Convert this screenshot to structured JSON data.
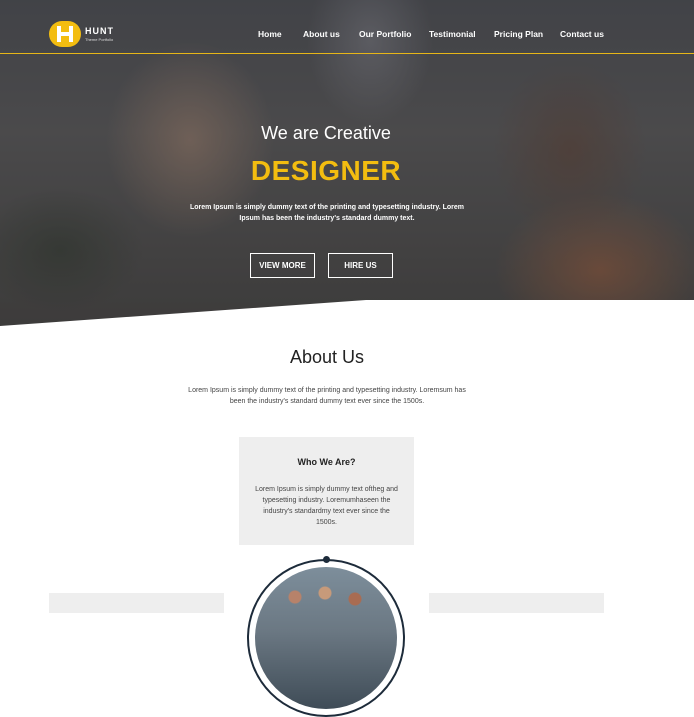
{
  "brand": {
    "name": "HUNT",
    "tagline": "Theme Portfolio",
    "accent": "#f3bd10"
  },
  "nav": {
    "items": [
      {
        "label": "Home"
      },
      {
        "label": "About us"
      },
      {
        "label": "Our Portfolio"
      },
      {
        "label": "Testimonial"
      },
      {
        "label": "Pricing Plan"
      },
      {
        "label": "Contact us"
      }
    ]
  },
  "hero": {
    "subtitle": "We are Creative",
    "title": "DESIGNER",
    "text": "Lorem Ipsum is simply dummy text of the printing and typesetting industry. Lorem Ipsum has been the industry's standard dummy text.",
    "buttons": {
      "view_more": "VIEW MORE",
      "hire_us": "HIRE US"
    }
  },
  "about": {
    "title": "About Us",
    "text": "Lorem Ipsum is simply dummy text of the printing and typesetting industry. Loremsum has been the industry's standard dummy text ever since the 1500s.",
    "card": {
      "title": "Who We Are?",
      "text": "Lorem Ipsum is simply dummy text oftheg and typesetting industry. Loremumhaseen the industry's standardmy text ever since the 1500s."
    }
  }
}
